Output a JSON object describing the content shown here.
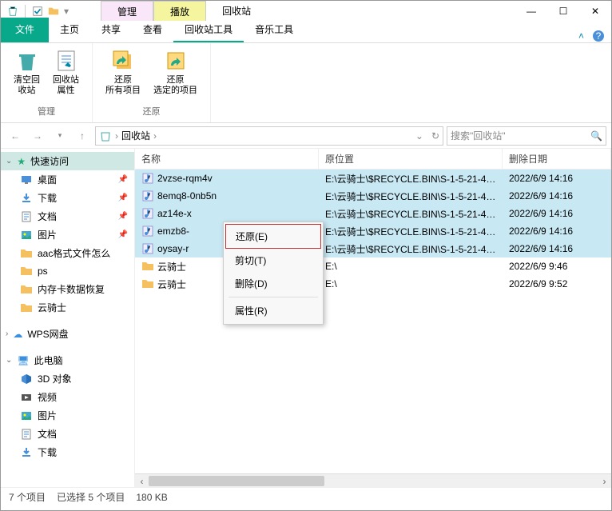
{
  "window": {
    "title": "回收站",
    "tool_tabs": [
      {
        "label": "管理",
        "color": "pink"
      },
      {
        "label": "播放",
        "color": "yellow"
      }
    ],
    "controls": {
      "min": "—",
      "max": "☐",
      "close": "✕"
    }
  },
  "menu": {
    "file": "文件",
    "tabs": [
      "主页",
      "共享",
      "查看",
      "回收站工具",
      "音乐工具"
    ],
    "active_index": 3
  },
  "ribbon": {
    "groups": [
      {
        "name": "管理",
        "buttons": [
          {
            "label": "清空回\n收站",
            "icon": "recycle-empty"
          },
          {
            "label": "回收站\n属性",
            "icon": "properties"
          }
        ]
      },
      {
        "name": "还原",
        "buttons": [
          {
            "label": "还原\n所有项目",
            "icon": "restore-all"
          },
          {
            "label": "还原\n选定的项目",
            "icon": "restore-selected"
          }
        ]
      }
    ]
  },
  "address": {
    "segments": [
      "回收站"
    ],
    "search_placeholder": "搜索\"回收站\""
  },
  "sidebar": {
    "quick": "快速访问",
    "items": [
      {
        "icon": "desktop",
        "label": "桌面",
        "pin": true
      },
      {
        "icon": "download",
        "label": "下载",
        "pin": true
      },
      {
        "icon": "document",
        "label": "文档",
        "pin": true
      },
      {
        "icon": "picture",
        "label": "图片",
        "pin": true
      },
      {
        "icon": "folder",
        "label": "aac格式文件怎么",
        "pin": false
      },
      {
        "icon": "folder",
        "label": "ps",
        "pin": false
      },
      {
        "icon": "folder",
        "label": "内存卡数据恢复",
        "pin": false
      },
      {
        "icon": "folder",
        "label": "云骑士",
        "pin": false
      }
    ],
    "wps": "WPS网盘",
    "thispc": "此电脑",
    "pc_items": [
      {
        "icon": "3d",
        "label": "3D 对象"
      },
      {
        "icon": "video",
        "label": "视频"
      },
      {
        "icon": "picture",
        "label": "图片"
      },
      {
        "icon": "document",
        "label": "文档"
      },
      {
        "icon": "download",
        "label": "下载"
      }
    ]
  },
  "columns": {
    "name": "名称",
    "location": "原位置",
    "date": "删除日期"
  },
  "files": [
    {
      "icon": "music",
      "name": "2vzse-rqm4v",
      "location": "E:\\云骑士\\$RECYCLE.BIN\\S-1-5-21-42...",
      "date": "2022/6/9 14:16",
      "selected": true
    },
    {
      "icon": "music",
      "name": "8emq8-0nb5n",
      "location": "E:\\云骑士\\$RECYCLE.BIN\\S-1-5-21-42...",
      "date": "2022/6/9 14:16",
      "selected": true
    },
    {
      "icon": "music",
      "name": "az14e-x",
      "location": "E:\\云骑士\\$RECYCLE.BIN\\S-1-5-21-42...",
      "date": "2022/6/9 14:16",
      "selected": true
    },
    {
      "icon": "music",
      "name": "emzb8-",
      "location": "E:\\云骑士\\$RECYCLE.BIN\\S-1-5-21-42...",
      "date": "2022/6/9 14:16",
      "selected": true
    },
    {
      "icon": "music",
      "name": "oysay-r",
      "location": "E:\\云骑士\\$RECYCLE.BIN\\S-1-5-21-42...",
      "date": "2022/6/9 14:16",
      "selected": true
    },
    {
      "icon": "folder",
      "name": "云骑士",
      "location": "E:\\",
      "date": "2022/6/9 9:46",
      "selected": false
    },
    {
      "icon": "folder",
      "name": "云骑士",
      "location": "E:\\",
      "date": "2022/6/9 9:52",
      "selected": false
    }
  ],
  "context_menu": {
    "items": [
      {
        "label": "还原(E)",
        "highlight": true
      },
      {
        "label": "剪切(T)"
      },
      {
        "label": "删除(D)"
      },
      {
        "sep": true
      },
      {
        "label": "属性(R)"
      }
    ]
  },
  "status": {
    "count": "7 个项目",
    "selected": "已选择 5 个项目",
    "size": "180 KB"
  }
}
